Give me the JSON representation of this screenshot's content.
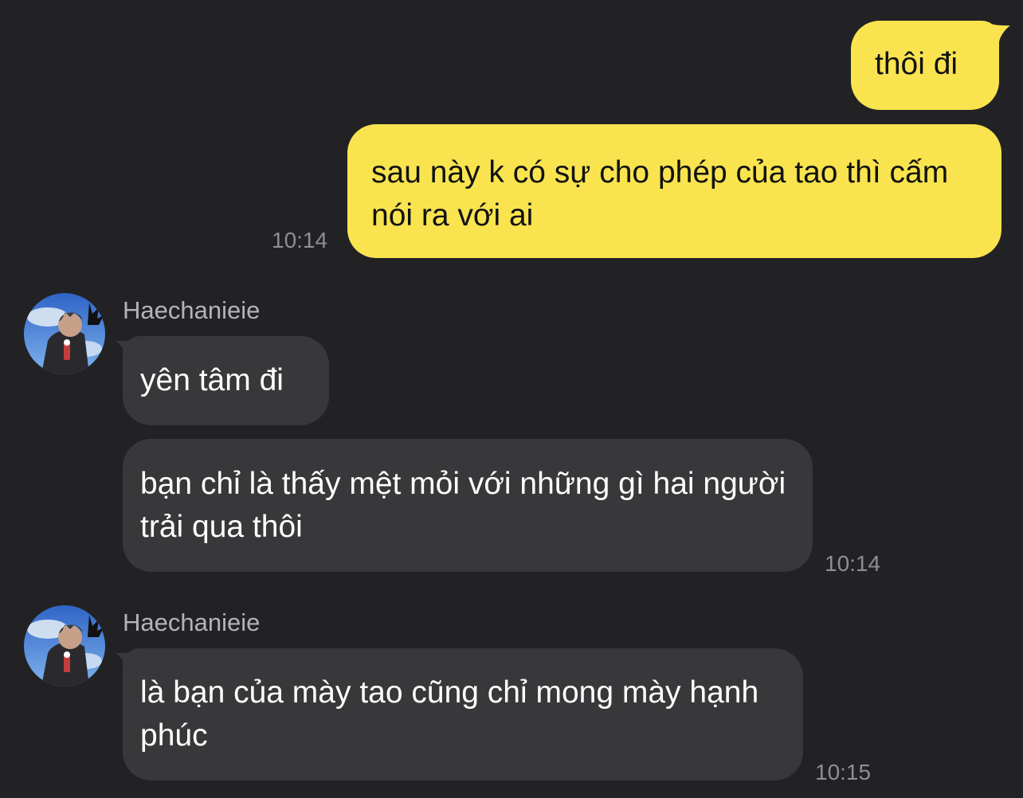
{
  "chat": {
    "outgoing": [
      {
        "text": "thôi đi"
      },
      {
        "text": "sau này k có sự cho phép của tao thì cấm nói ra với ai",
        "time": "10:14"
      }
    ],
    "groups": [
      {
        "sender": "Haechanieie",
        "avatar_icon": "profile-photo-avatar",
        "messages": [
          {
            "text": "yên tâm đi"
          },
          {
            "text": "bạn chỉ là thấy mệt mỏi với những gì hai người trải qua thôi",
            "time": "10:14"
          }
        ]
      },
      {
        "sender": "Haechanieie",
        "avatar_icon": "profile-photo-avatar",
        "messages": [
          {
            "text": "là bạn của mày tao cũng chỉ mong mày hạnh phúc",
            "time": "10:15"
          }
        ]
      }
    ]
  },
  "colors": {
    "background": "#222224",
    "outgoing_bubble": "#f9e44f",
    "incoming_bubble": "#38383b",
    "timestamp": "#8e8e93",
    "sender_name": "#b4b4b8"
  }
}
